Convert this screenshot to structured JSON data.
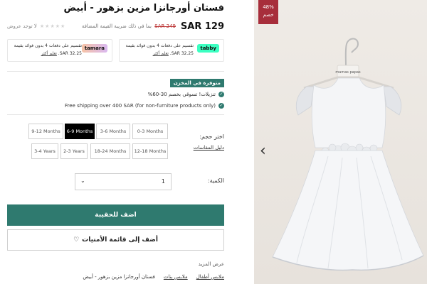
{
  "product": {
    "title": "فستان أورجانزا مزين بزهور - أبيض",
    "price": "SAR 129",
    "old_price": "SAR 249",
    "vat_note": "بما في ذلك ضريبة القيمة المضافة",
    "no_reviews": "لا توجد عروض",
    "stars": "★★★★★"
  },
  "bnpl": {
    "tabby": {
      "logo": "tabby",
      "line1": "تقسيم على دفعات 4 بدون فوائد بقيمة",
      "amount": "SAR 32.25",
      "learn": "تعلم أكثر"
    },
    "tamara": {
      "logo": "tamara",
      "line1": "تقسيم على دفعات 4 بدون فوائد بقيمة",
      "amount": "SAR 32.25",
      "learn": "تعلم أكثر"
    }
  },
  "stock": {
    "badge": "متوفرة في المخزن",
    "benefit1": "تنزيلات! تسوقي بخصم 30-60%",
    "benefit2": "Free shipping over 400 SAR (for non-furniture products only)"
  },
  "sizes": {
    "label": "اختر حجم:",
    "guide": "دليل المقاسات",
    "options": [
      "0-3 Months",
      "3-6 Months",
      "6-9 Months",
      "9-12 Months",
      "12-18 Months",
      "18-24 Months",
      "2-3 Years",
      "3-4 Years"
    ],
    "selected": "6-9 Months"
  },
  "quantity": {
    "label": "الكمية:",
    "value": "1"
  },
  "actions": {
    "add_to_bag": "اضف للحقيبة",
    "wishlist": "أضف إلى قائمة الأمنيات"
  },
  "more": {
    "label": "عرض المزيد",
    "links": [
      "ملابس أطفال",
      "ملابس بنات",
      "فستان أورجانزا مزين بزهور - أبيض"
    ]
  },
  "gallery": {
    "badge_percent": "48%",
    "badge_text": "خصم",
    "hanger_brand": "mamas papas"
  },
  "colors": {
    "accent": "#2f7a6f",
    "badge": "#a72e3b",
    "tabby": "#3bffc1"
  }
}
